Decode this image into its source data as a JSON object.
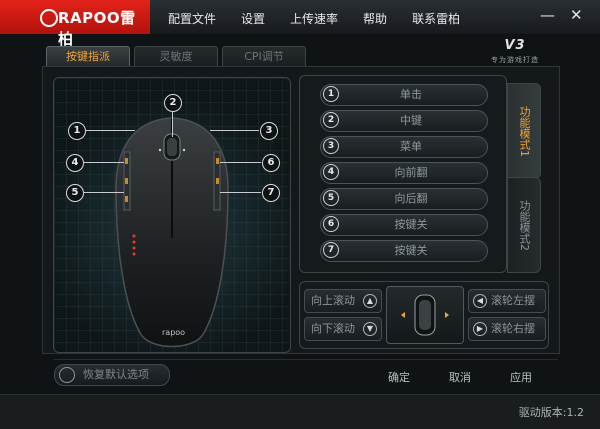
{
  "app": {
    "logo_text": "RAPOO雷柏",
    "menu": [
      "配置文件",
      "设置",
      "上传速率",
      "帮助",
      "联系雷柏"
    ],
    "minimize_glyph": "—",
    "close_glyph": "✕"
  },
  "tabs": [
    {
      "label": "按键指派",
      "active": true
    },
    {
      "label": "灵敏度",
      "active": false
    },
    {
      "label": "CPI调节",
      "active": false
    }
  ],
  "brand": {
    "logo": "V3",
    "sub": "专为游戏打造"
  },
  "callouts": [
    "1",
    "2",
    "3",
    "4",
    "5",
    "6",
    "7"
  ],
  "mouse": {
    "logo": "rapoo"
  },
  "functions": [
    {
      "num": "1",
      "label": "单击"
    },
    {
      "num": "2",
      "label": "中键"
    },
    {
      "num": "3",
      "label": "菜单"
    },
    {
      "num": "4",
      "label": "向前翻"
    },
    {
      "num": "5",
      "label": "向后翻"
    },
    {
      "num": "6",
      "label": "按键关"
    },
    {
      "num": "7",
      "label": "按键关"
    }
  ],
  "modes": [
    {
      "label": "功能模式1",
      "active": true
    },
    {
      "label": "功能模式2",
      "active": false
    }
  ],
  "scroll": {
    "up": "向上滚动",
    "down": "向下滚动",
    "left": "滚轮左摆",
    "right": "滚轮右摆"
  },
  "reset_label": "恢复默认选项",
  "actions": {
    "ok": "确定",
    "cancel": "取消",
    "apply": "应用"
  },
  "version": "驱动版本:1.2",
  "colors": {
    "accent": "#f2a43a",
    "brand_red": "#e2231a"
  }
}
